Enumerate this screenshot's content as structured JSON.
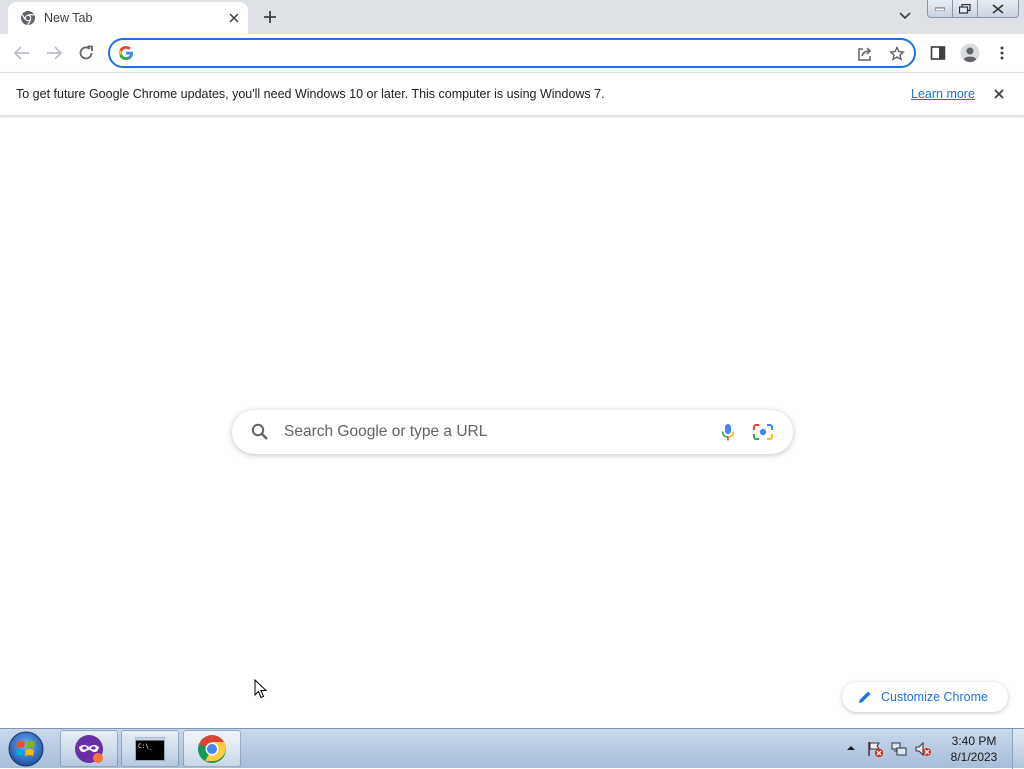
{
  "tab": {
    "title": "New Tab"
  },
  "omnibox": {
    "value": ""
  },
  "infobar": {
    "message": "To get future Google Chrome updates, you'll need Windows 10 or later. This computer is using Windows 7.",
    "learn_more": "Learn more"
  },
  "ntp": {
    "search_placeholder": "Search Google or type a URL",
    "customize_label": "Customize Chrome"
  },
  "taskbar": {
    "apps": [
      "private-browser",
      "command-prompt",
      "google-chrome"
    ],
    "clock_time": "3:40 PM",
    "clock_date": "8/1/2023"
  },
  "colors": {
    "accent": "#1a73e8",
    "tabstrip": "#dee1e6",
    "taskbar": "#b9cbe1"
  }
}
